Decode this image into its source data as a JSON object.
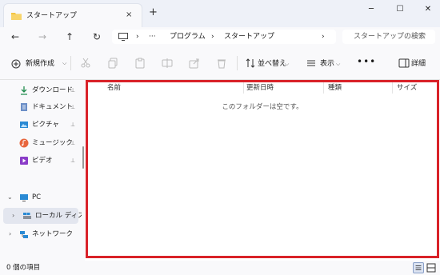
{
  "tab": {
    "title": "スタートアップ",
    "close_icon": "×",
    "new_tab_icon": "+"
  },
  "window": {
    "minimize": "─",
    "maximize": "☐",
    "close": "✕"
  },
  "nav": {
    "back": "←",
    "forward": "→",
    "up": "↑",
    "refresh": "↻"
  },
  "address": {
    "sep1": "›",
    "overflow": "···",
    "crumb1": "プログラム",
    "sep2": "›",
    "crumb2": "スタートアップ",
    "sep3": "›"
  },
  "search": {
    "placeholder": "スタートアップの検索"
  },
  "commands": {
    "new": "新規作成",
    "new_chevron": "⌵",
    "sort": "並べ替え",
    "view": "表示",
    "more": "•••",
    "details": "詳細"
  },
  "sidebar": {
    "items": [
      {
        "label": "ダウンロード"
      },
      {
        "label": "ドキュメント"
      },
      {
        "label": "ピクチャ"
      },
      {
        "label": "ミュージック"
      },
      {
        "label": "ビデオ"
      },
      {
        "label": "PC"
      },
      {
        "label": "ローカル ディスク"
      },
      {
        "label": "ネットワーク"
      }
    ],
    "pin": "📌"
  },
  "columns": [
    "名前",
    "更新日時",
    "種類",
    "サイズ"
  ],
  "content": {
    "empty_message": "このフォルダーは空です。"
  },
  "status": {
    "items": "0 個の項目"
  },
  "colors": {
    "highlight_border": "#d92229",
    "accent": "#0067c0",
    "folder": "#f4c542"
  }
}
